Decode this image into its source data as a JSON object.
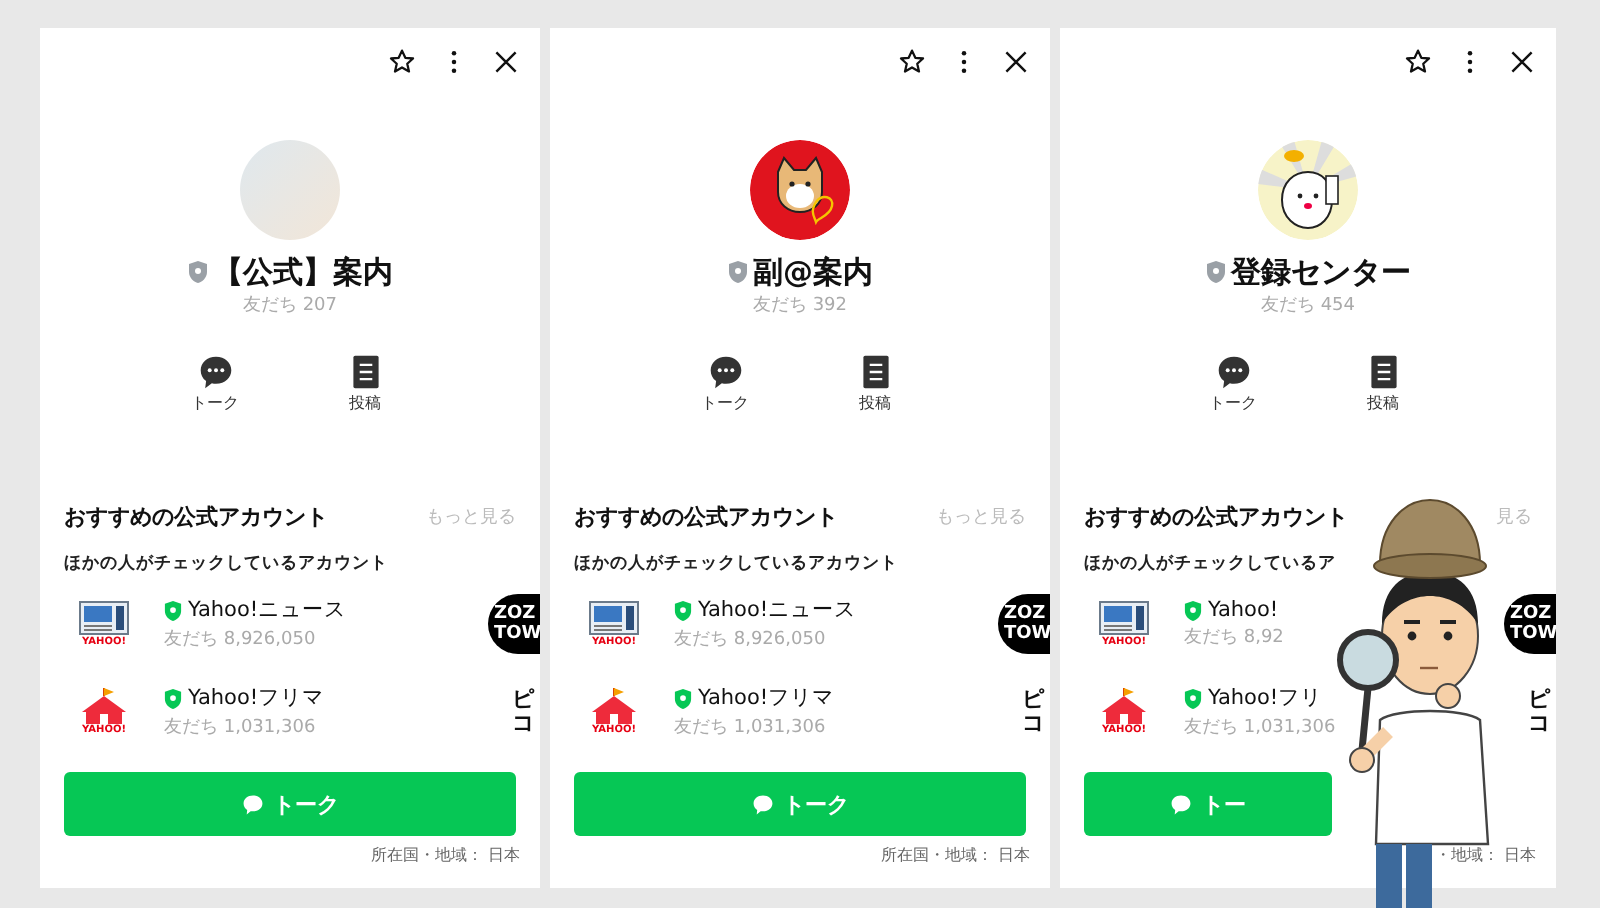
{
  "panels": [
    {
      "avatar": {
        "kind": "photo"
      },
      "name": "【公式】案内",
      "friends": "友だち 207",
      "actions": [
        {
          "kind": "talk",
          "label": "トーク"
        },
        {
          "kind": "post",
          "label": "投稿"
        }
      ],
      "section_title": "おすすめの公式アカウント",
      "more": "もっと見る",
      "subtitle": "ほかの人がチェックしているアカウント",
      "accounts": [
        {
          "kind": "news",
          "logo_text": "YAHOO!",
          "name": "Yahoo!ニュース",
          "friends": "友だち 8,926,050"
        },
        {
          "kind": "tent",
          "logo_text": "YAHOO!",
          "name": "Yahoo!フリマ",
          "friends": "友だち 1,031,306"
        }
      ],
      "side_logos": [
        {
          "kind": "circle",
          "lines": [
            "ZOZ",
            "TOW"
          ]
        },
        {
          "kind": "plain",
          "lines": [
            "ピ",
            "コ"
          ]
        }
      ],
      "talk_button": "トーク",
      "footer": "所在国・地域： 日本"
    },
    {
      "avatar": {
        "kind": "dog"
      },
      "name": "副@案内",
      "friends": "友だち 392",
      "actions": [
        {
          "kind": "talk",
          "label": "トーク"
        },
        {
          "kind": "post",
          "label": "投稿"
        }
      ],
      "section_title": "おすすめの公式アカウント",
      "more": "もっと見る",
      "subtitle": "ほかの人がチェックしているアカウント",
      "accounts": [
        {
          "kind": "news",
          "logo_text": "YAHOO!",
          "name": "Yahoo!ニュース",
          "friends": "友だち 8,926,050"
        },
        {
          "kind": "tent",
          "logo_text": "YAHOO!",
          "name": "Yahoo!フリマ",
          "friends": "友だち 1,031,306"
        }
      ],
      "side_logos": [
        {
          "kind": "circle",
          "lines": [
            "ZOZ",
            "TOW"
          ]
        },
        {
          "kind": "plain",
          "lines": [
            "ピ",
            "コ"
          ]
        }
      ],
      "talk_button": "トーク",
      "footer": "所在国・地域： 日本"
    },
    {
      "avatar": {
        "kind": "rays"
      },
      "name": "登録センター",
      "friends": "友だち 454",
      "actions": [
        {
          "kind": "talk",
          "label": "トーク"
        },
        {
          "kind": "post",
          "label": "投稿"
        }
      ],
      "section_title": "おすすめの公式アカウント",
      "more": "見る",
      "subtitle": "ほかの人がチェックしているア",
      "accounts": [
        {
          "kind": "news",
          "logo_text": "YAHOO!",
          "name": "Yahoo!",
          "friends": "友だち 8,92"
        },
        {
          "kind": "tent",
          "logo_text": "YAHOO!",
          "name": "Yahoo!フリ",
          "friends": "友だち 1,031,306"
        }
      ],
      "side_logos": [
        {
          "kind": "circle",
          "lines": [
            "ZOZ",
            "TOW"
          ]
        },
        {
          "kind": "plain",
          "lines": [
            "ピ",
            "コ"
          ]
        }
      ],
      "talk_button": "トー",
      "footer": "・地域： 日本"
    }
  ],
  "illustration": {
    "kind": "detective"
  }
}
